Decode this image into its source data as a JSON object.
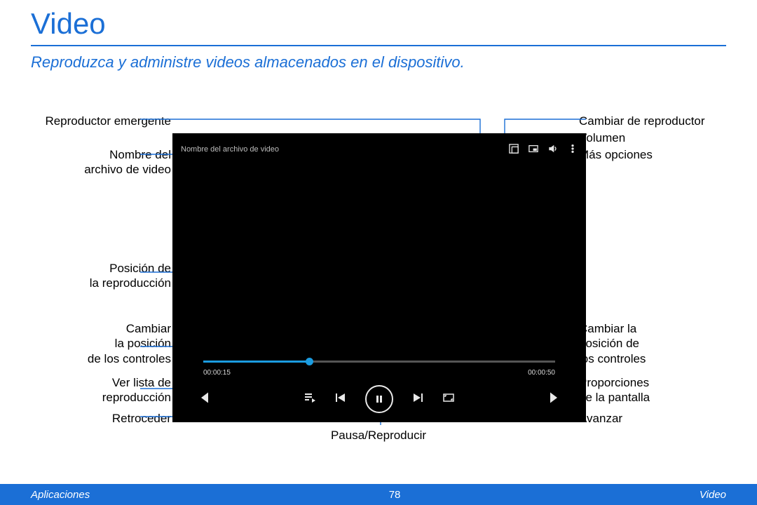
{
  "title": "Video",
  "subtitle": "Reproduzca y administre videos almacenados en el dispositivo.",
  "labels_left": {
    "popup": "Reproductor emergente",
    "filename": "Nombre del\narchivo de video",
    "position": "Posición de\nla reproducción",
    "move_ctrl": "Cambiar\nla posición\nde los controles",
    "playlist": "Ver lista de\nreproducción",
    "rewind": "Retroceder"
  },
  "labels_right": {
    "switch_player": "Cambiar de reproductor",
    "volume": "Volumen",
    "more": "Más opciones",
    "move_ctrl": "Cambiar la\nposición de\nlos controles",
    "ratio": "Proporciones\nde la pantalla",
    "forward": "Avanzar"
  },
  "labels_center": {
    "pause": "Pausa/Reproducir"
  },
  "player": {
    "filename_overlay": "Nombre del archivo de video",
    "time_current": "00:00:15",
    "time_total": "00:00:50"
  },
  "footer": {
    "left": "Aplicaciones",
    "page": "78",
    "right": "Video"
  }
}
